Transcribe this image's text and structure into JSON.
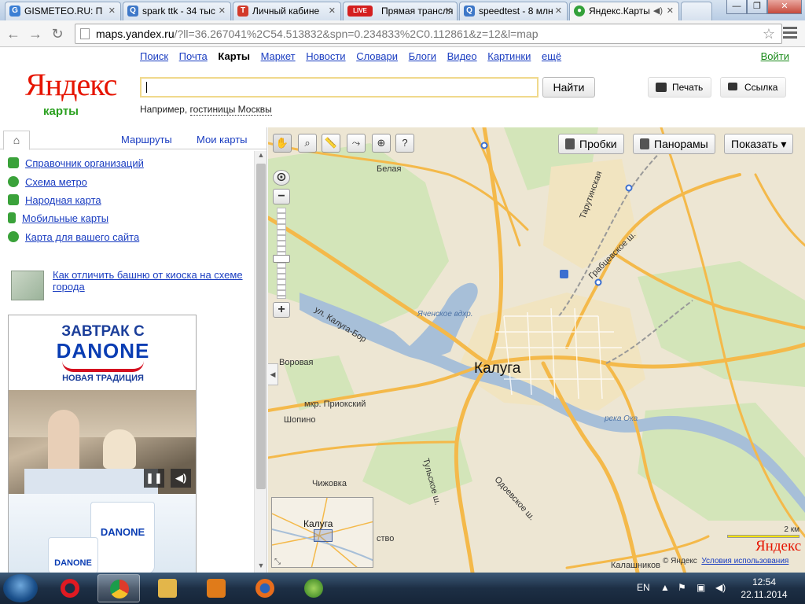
{
  "browser": {
    "tabs": [
      {
        "title": "GISMETEO.RU: П",
        "icon": "gismeteo-icon"
      },
      {
        "title": "spark ttk - 34 тыс",
        "icon": "search-icon"
      },
      {
        "title": "Личный кабине",
        "icon": "t-icon"
      },
      {
        "title": "Прямая трансля",
        "icon": "live-icon",
        "badge": "LIVE"
      },
      {
        "title": "speedtest - 8 млн",
        "icon": "search-icon"
      },
      {
        "title": "Яндекс.Карты",
        "icon": "yandex-maps-icon"
      }
    ],
    "url_domain": "maps.yandex.ru",
    "url_rest": "/?ll=36.267041%2C54.513832&spn=0.234833%2C0.112861&z=12&l=map"
  },
  "header": {
    "logo": "Яндекс",
    "logo_sub": "карты",
    "services": [
      "Поиск",
      "Почта",
      "Карты",
      "Маркет",
      "Новости",
      "Словари",
      "Блоги",
      "Видео",
      "Картинки",
      "ещё"
    ],
    "active_service": "Карты",
    "login": "Войти",
    "search_value": "",
    "find_button": "Найти",
    "example_prefix": "Например,",
    "example_link": "гостиницы Москвы",
    "print_button": "Печать",
    "link_button": "Ссылка"
  },
  "sidebar": {
    "tabs": [
      "Маршруты",
      "Мои карты"
    ],
    "links": [
      {
        "label": "Справочник организаций",
        "color": "#2a9c2a"
      },
      {
        "label": "Схема метро",
        "color": "#2a9c2a"
      },
      {
        "label": "Народная карта",
        "color": "#2a9c2a"
      },
      {
        "label": "Мобильные карты",
        "color": "#2a9c2a"
      },
      {
        "label": "Карта для вашего сайта",
        "color": "#2a9c2a"
      }
    ],
    "tip": "Как отличить башню от киоска на схеме города",
    "ad": {
      "line1": "ЗАВТРАК С",
      "brand": "DANONE",
      "line3": "НОВАЯ ТРАДИЦИЯ",
      "cup_brand": "DANONE"
    }
  },
  "map": {
    "buttons": {
      "traffic": "Пробки",
      "panoramas": "Панорамы",
      "show": "Показать ▾"
    },
    "labels": {
      "city": "Калуга",
      "belaya": "Белая",
      "vorovaya": "Воровая",
      "prioksky": "мкр. Приокский",
      "shopino": "Шопино",
      "chizhovka": "Чижовка",
      "kalashnikovo": "Калашников",
      "street_kaluga_bor": "ул. Калуга-Бор",
      "street_tulskoe": "Тульское ш.",
      "street_odoevskoe": "Одоевское ш.",
      "street_grabtsevskoe": "Грабцевское ш.",
      "street_tarutinskaya": "Тарутинская",
      "reservoir": "Яченское вдхр.",
      "river": "река Ока",
      "minimap_city": "Калуга",
      "minimap_partial": "ство"
    },
    "scale": "2 км",
    "map_logo": "Яндекс",
    "copyright": "© Яндекс",
    "terms": "Условия использования",
    "colors": {
      "road": "#f4b94a",
      "water": "#a7bfd8",
      "forest": "#cfe2b3",
      "background": "#ede6d3"
    }
  },
  "taskbar": {
    "lang": "EN",
    "time": "12:54",
    "date": "22.11.2014"
  }
}
